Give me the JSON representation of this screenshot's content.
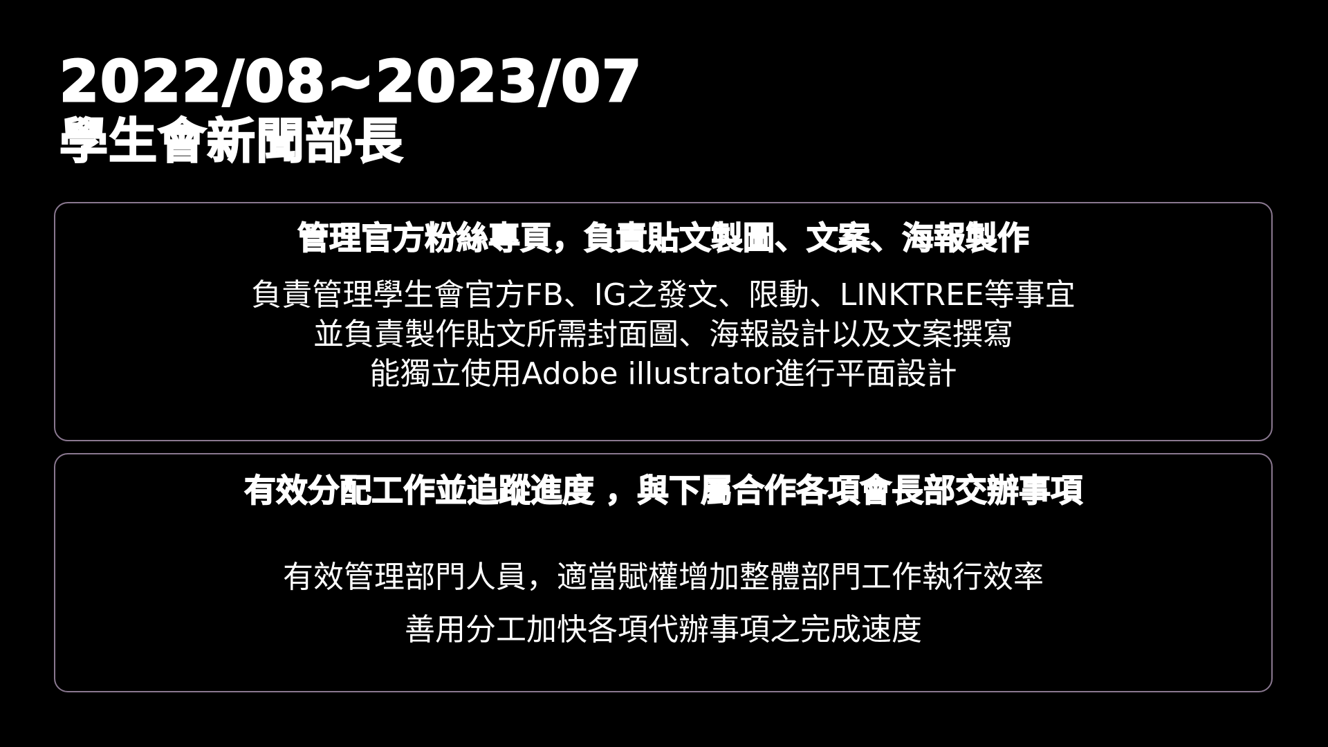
{
  "header": {
    "date_range": "2022/08~2023/07",
    "role": "學生會新聞部長"
  },
  "cards": [
    {
      "heading": "管理官方粉絲專頁，負責貼文製圖、文案、海報製作",
      "lines": [
        "負責管理學生會官方FB、IG之發文、限動、LINKTREE等事宜",
        "並負責製作貼文所需封面圖、海報設計以及文案撰寫",
        "能獨立使用Adobe illustrator進行平面設計"
      ]
    },
    {
      "heading": "有效分配工作並追蹤進度 ，與下屬合作各項會長部交辦事項",
      "lines": [
        "有效管理部門人員，適當賦權增加整體部門工作執行效率",
        "善用分工加快各項代辦事項之完成速度"
      ]
    }
  ],
  "colors": {
    "background": "#000000",
    "text": "#ffffff",
    "card_border": "#8a7890"
  }
}
